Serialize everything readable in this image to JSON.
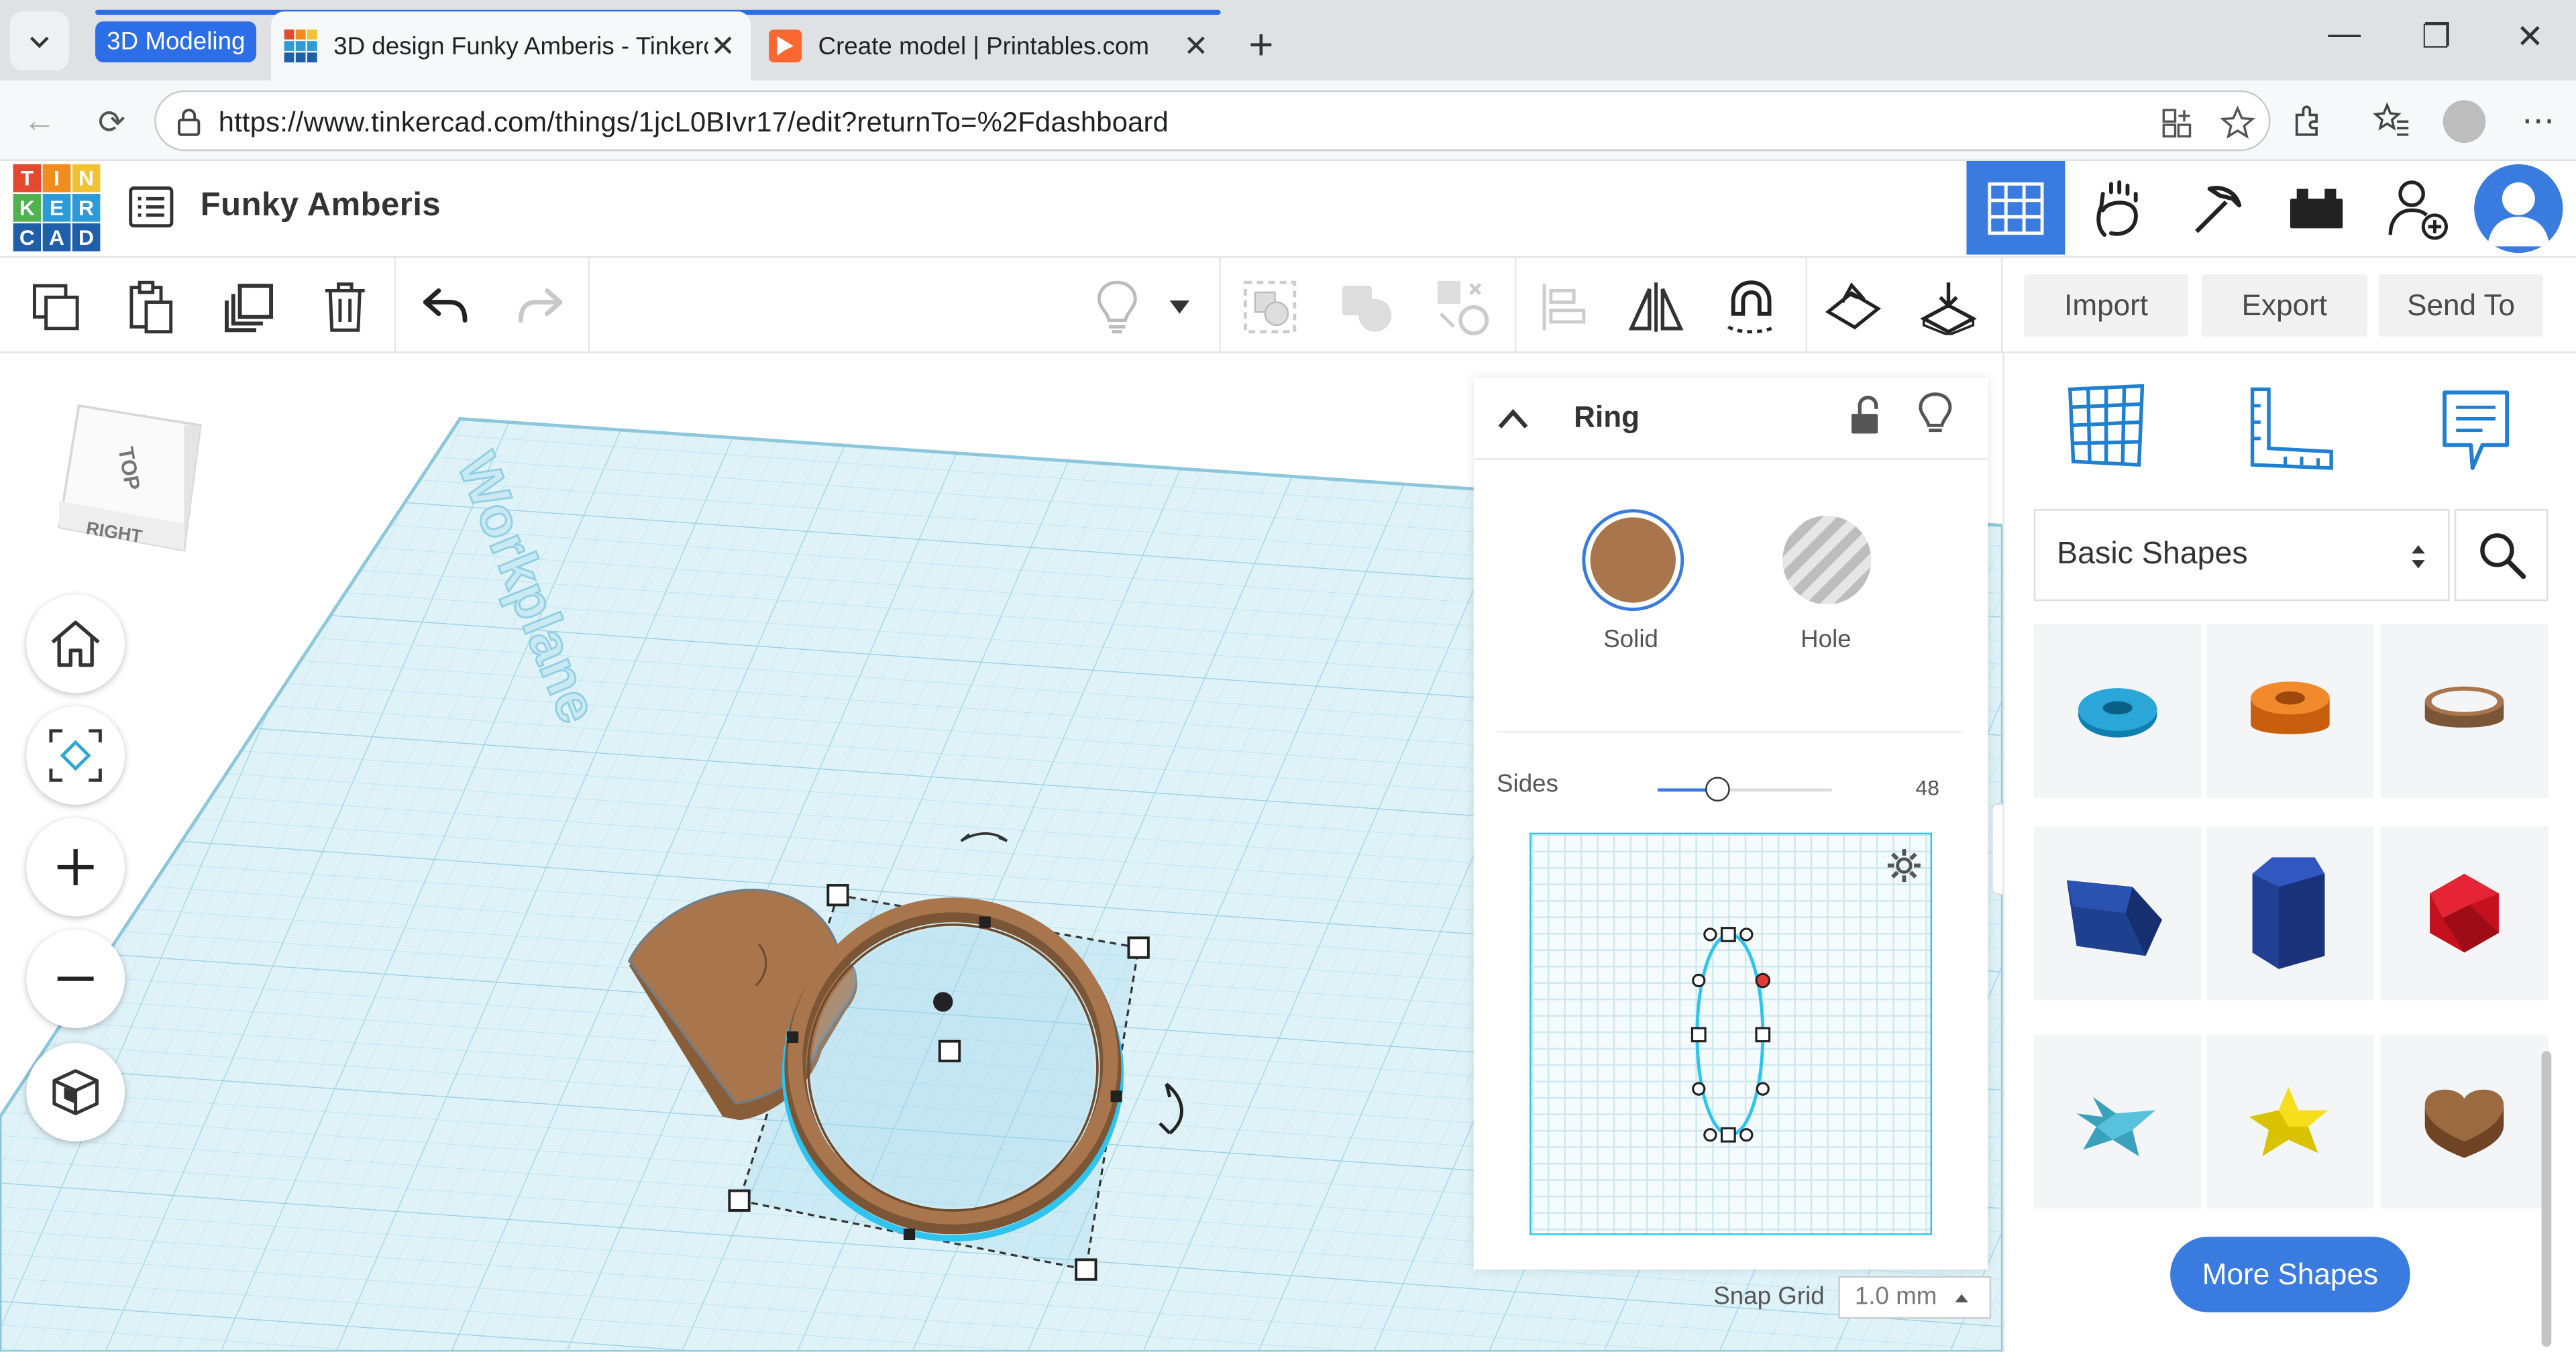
{
  "browser": {
    "tab_group_label": "3D Modeling",
    "tabs": [
      {
        "title": "3D design Funky Amberis - Tinkercad",
        "active": true
      },
      {
        "title": "Create model | Printables.com",
        "active": false
      }
    ],
    "url": "https://www.tinkercad.com/things/1jcL0BIvr17/edit?returnTo=%2Fdashboard"
  },
  "logo": {
    "letters": [
      "T",
      "I",
      "N",
      "K",
      "E",
      "R",
      "C",
      "A",
      "D"
    ],
    "colors": [
      "#e2492f",
      "#f38c1e",
      "#f1c232",
      "#2d9bd8",
      "#2d9bd8",
      "#2d9bd8",
      "#1f5ea8",
      "#1f5ea8",
      "#1f5ea8"
    ]
  },
  "header": {
    "design_title": "Funky Amberis"
  },
  "toolbar": {
    "import_label": "Import",
    "export_label": "Export",
    "send_to_label": "Send To"
  },
  "viewcube": {
    "top_label": "TOP",
    "right_label": "RIGHT"
  },
  "workplane": {
    "label": "Workplane"
  },
  "inspector": {
    "shape_name": "Ring",
    "solid_label": "Solid",
    "hole_label": "Hole",
    "sides_label": "Sides",
    "sides_value": "48",
    "solid_color": "#a8754c"
  },
  "snap": {
    "label": "Snap Grid",
    "value": "1.0 mm"
  },
  "library": {
    "category": "Basic Shapes",
    "more_shapes_label": "More Shapes",
    "shapes": [
      "torus-blue",
      "tube-orange",
      "ring-brown",
      "wedge-navy",
      "pentagon-prism-navy",
      "icosahedron-red",
      "star-teal",
      "star-yellow",
      "heart-brown"
    ]
  },
  "colors": {
    "accent": "#3a7be0",
    "brand_blue": "#2c6de8",
    "selection": "#2ec4ef"
  }
}
